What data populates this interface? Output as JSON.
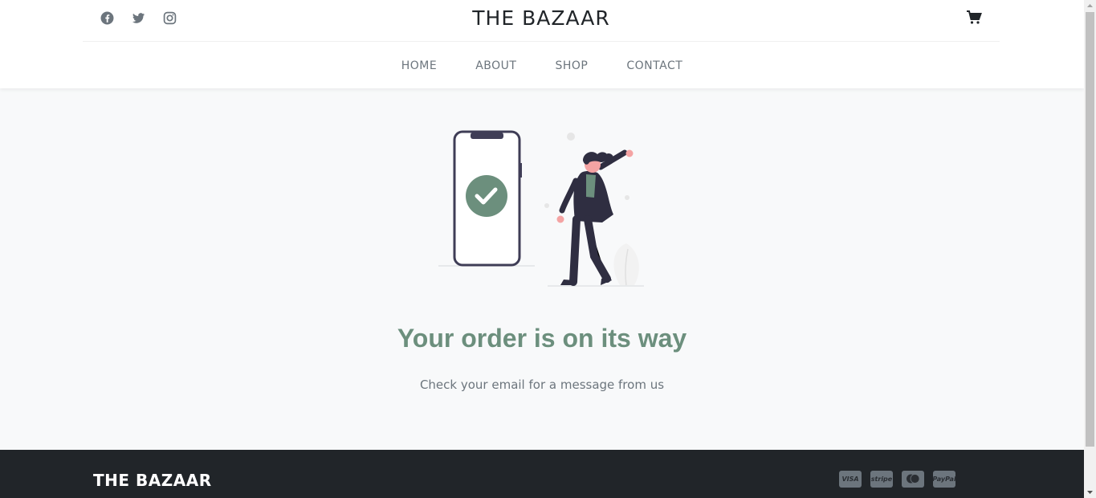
{
  "header": {
    "brand": "THE BAZAAR",
    "social_icons": [
      "facebook-icon",
      "twitter-icon",
      "instagram-icon"
    ],
    "cart_icon": "cart-icon"
  },
  "nav": {
    "items": [
      {
        "label": "HOME"
      },
      {
        "label": "ABOUT"
      },
      {
        "label": "SHOP"
      },
      {
        "label": "CONTACT"
      }
    ]
  },
  "main": {
    "title": "Your order is on its way",
    "subtitle": "Check your email for a message from us"
  },
  "footer": {
    "brand": "THE BAZAAR",
    "payments": [
      "VISA",
      "stripe",
      "",
      "PayPal"
    ]
  },
  "colors": {
    "accent": "#6c8f7d",
    "footer_bg": "#212529",
    "nav_text": "#6c757d"
  }
}
